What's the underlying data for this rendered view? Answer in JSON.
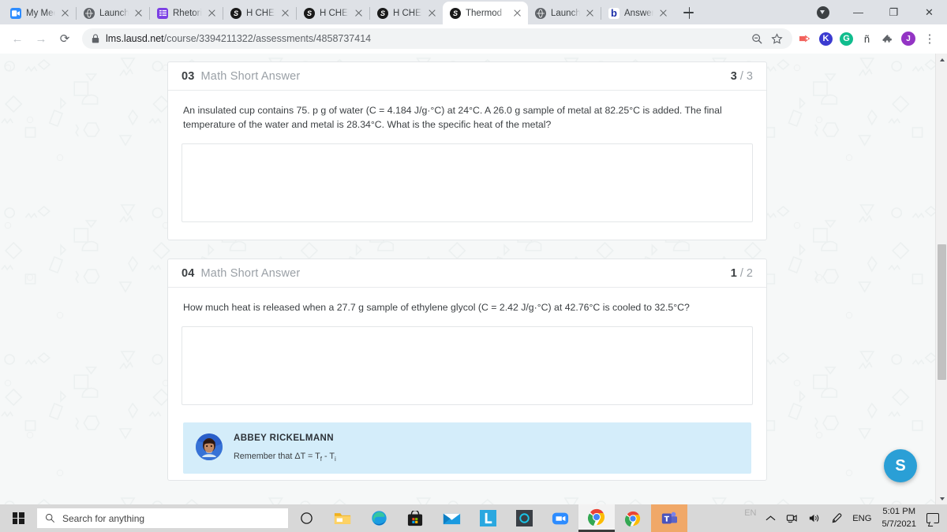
{
  "browser": {
    "tabs": [
      {
        "title": "My Meeti",
        "favicon": "zoom-icon",
        "fav_bg": "#2d8cff",
        "fav_glyph": "▶",
        "active": false
      },
      {
        "title": "Launch M",
        "favicon": "globe-icon",
        "fav_bg": "#5f6368",
        "fav_glyph": "⊕",
        "active": false
      },
      {
        "title": "Rhetorica",
        "favicon": "forms-icon",
        "fav_bg": "#7b3fe4",
        "fav_glyph": "☰",
        "active": false
      },
      {
        "title": "H CHEMI",
        "favicon": "schoology-icon",
        "fav_bg": "#1a1a1a",
        "fav_glyph": "S",
        "active": false
      },
      {
        "title": "H CHEMI",
        "favicon": "schoology-icon",
        "fav_bg": "#1a1a1a",
        "fav_glyph": "S",
        "active": false
      },
      {
        "title": "H CHEMI",
        "favicon": "schoology-icon",
        "fav_bg": "#1a1a1a",
        "fav_glyph": "S",
        "active": false
      },
      {
        "title": "Thermod",
        "favicon": "schoology-icon",
        "fav_bg": "#1a1a1a",
        "fav_glyph": "S",
        "active": true
      },
      {
        "title": "Launch M",
        "favicon": "globe-icon",
        "fav_bg": "#5f6368",
        "fav_glyph": "⊕",
        "active": false
      },
      {
        "title": "Answered",
        "favicon": "brainly-icon",
        "fav_bg": "#ffffff",
        "fav_glyph": "b",
        "active": false
      }
    ],
    "new_tab_label": "+",
    "window_controls": {
      "minimize": "—",
      "maximize": "❐",
      "close": "✕"
    },
    "nav": {
      "back": "←",
      "forward": "→",
      "reload": "⟳"
    },
    "omnibox": {
      "lock": "🔒",
      "host": "lms.lausd.net",
      "path": "/course/3394211322/assessments/4858737414",
      "full_url": "lms.lausd.net/course/3394211322/assessments/4858737414",
      "zoom_icon": "zoom-out-icon",
      "bookmark_icon": "star-icon"
    },
    "extensions": [
      {
        "name": "pdf-tool-extension",
        "letter": "▶",
        "bg": "#ffffff",
        "fg": "#f2625c"
      },
      {
        "name": "kami-extension",
        "letter": "K",
        "bg": "#3b3bd0",
        "fg": "#ffffff"
      },
      {
        "name": "grammarly-extension",
        "letter": "G",
        "bg": "#11bd8e",
        "fg": "#ffffff"
      },
      {
        "name": "enye-extension",
        "letter": "ñ",
        "bg": "#ffffff",
        "fg": "#3c4043"
      },
      {
        "name": "puzzle-extension",
        "letter": "🧩",
        "bg": "#ffffff",
        "fg": "#5f6368"
      },
      {
        "name": "profile-avatar",
        "letter": "J",
        "bg": "#9334c4",
        "fg": "#ffffff"
      }
    ],
    "menu_icon": "⋮"
  },
  "questions": [
    {
      "number": "03",
      "type": "Math Short Answer",
      "score_earned": "3",
      "score_total": "3",
      "text": "An insulated cup contains 75. p g of water (C = 4.184 J/g·°C) at 24°C. A 26.0 g sample of metal at 82.25°C is added. The final temperature of the water and metal is 28.34°C. What is the specific heat of the metal?",
      "answer_value": "",
      "answer_placeholder": ""
    },
    {
      "number": "04",
      "type": "Math Short Answer",
      "score_earned": "1",
      "score_total": "2",
      "text": "How much heat is released when a  27.7 g sample of ethylene glycol (C = 2.42 J/g·°C) at 42.76°C is cooled to 32.5°C?",
      "answer_value": "",
      "answer_placeholder": ""
    }
  ],
  "comment": {
    "author": "ABBEY RICKELMANN",
    "body_prefix": "Remember that ΔT = T",
    "body_sub1": "f",
    "body_mid": " - T",
    "body_sub2": "i",
    "body_full": "Remember that ΔT = Tf - Ti",
    "background": "#d4edfa"
  },
  "fab": {
    "label": "S",
    "color": "#2a9fd6",
    "name": "schoology-help-button"
  },
  "scrollbar": {
    "up_arrow": "▲",
    "down_arrow": "▼"
  },
  "taskbar": {
    "start_label": "start-button",
    "search_placeholder": "Search for anything",
    "search_value": "",
    "cortana_label": "○",
    "apps": [
      {
        "name": "file-explorer",
        "glyph": "🗀",
        "bg": "",
        "active": false
      },
      {
        "name": "microsoft-edge",
        "glyph": "e",
        "bg": "",
        "active": false
      },
      {
        "name": "microsoft-store",
        "glyph": "🛎",
        "bg": "",
        "active": false
      },
      {
        "name": "mail",
        "glyph": "✉",
        "bg": "",
        "active": false
      },
      {
        "name": "lausd-app",
        "glyph": "L",
        "bg": "",
        "active": false
      },
      {
        "name": "cortana-app",
        "glyph": "○",
        "bg": "",
        "active": false
      },
      {
        "name": "zoom-app",
        "glyph": "📹",
        "bg": "",
        "active": false
      },
      {
        "name": "google-chrome",
        "glyph": "C",
        "bg": "",
        "active": true
      },
      {
        "name": "google-chrome-2",
        "glyph": "C",
        "bg": "",
        "active": false
      },
      {
        "name": "microsoft-teams",
        "glyph": "T",
        "bg": "#f0a868",
        "active": false
      }
    ],
    "tray": {
      "ghost_lang": "EN",
      "chevron": "⌃",
      "camera_icon": "camera-icon",
      "volume_icon": "volume-icon",
      "pen_icon": "pen-icon",
      "language": "ENG",
      "time": "5:01 PM",
      "date": "5/7/2021",
      "action_center": "notification-icon"
    }
  }
}
